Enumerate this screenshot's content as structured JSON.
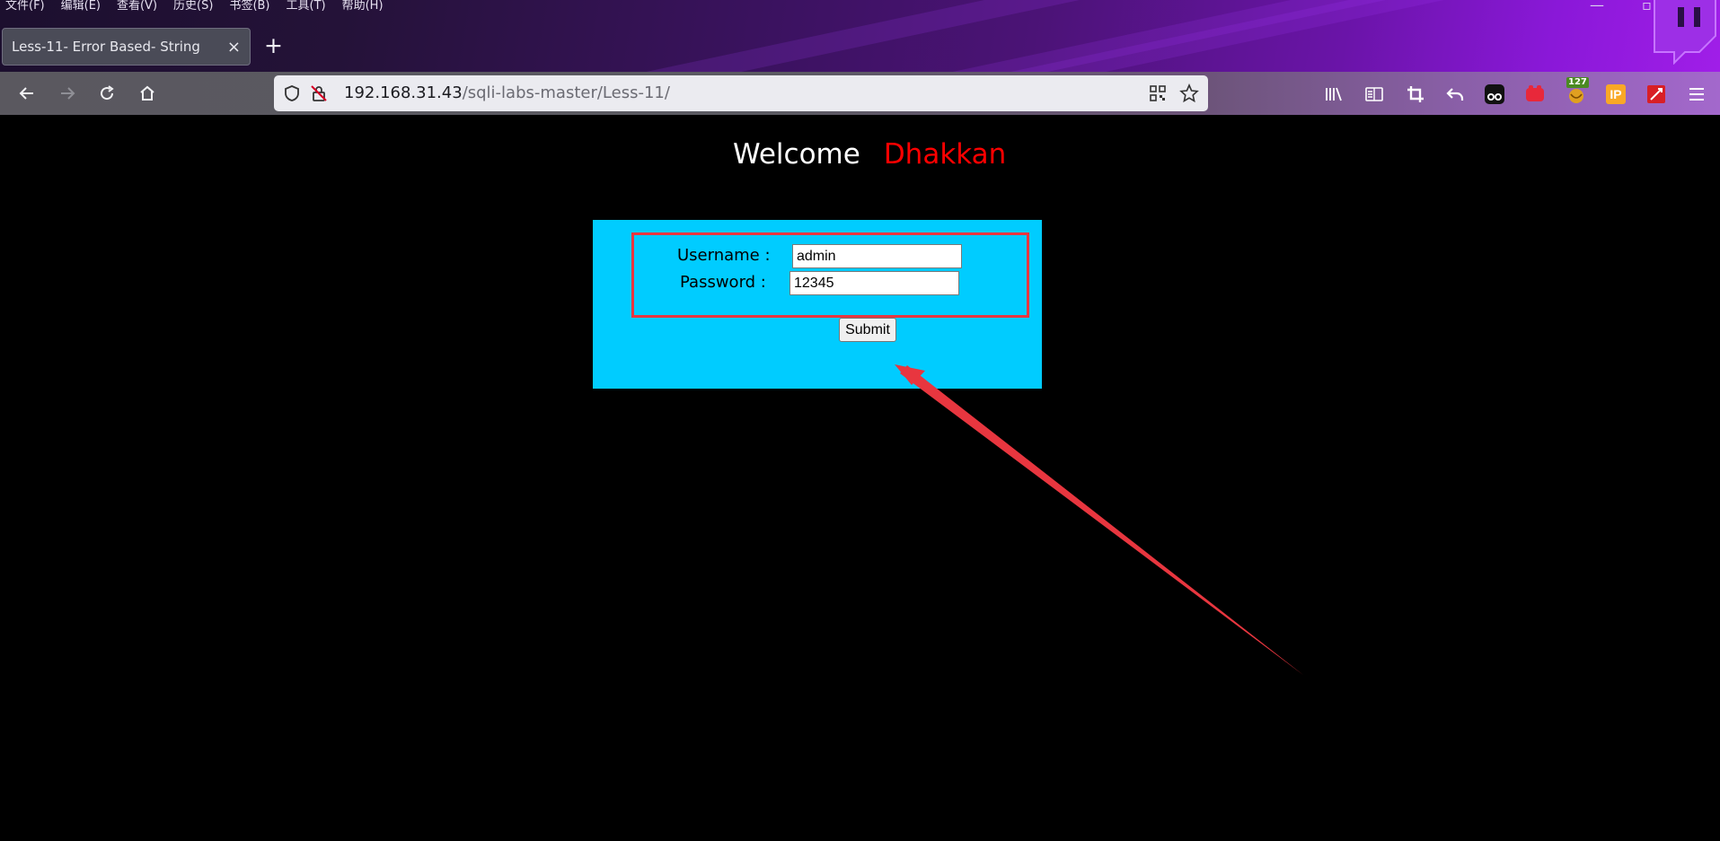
{
  "menu": [
    "文件(F)",
    "编辑(E)",
    "查看(V)",
    "历史(S)",
    "书签(B)",
    "工具(T)",
    "帮助(H)"
  ],
  "window_controls": {
    "minimize": "—",
    "restore": "▫",
    "close": "✕"
  },
  "tab": {
    "title": "Less-11- Error Based- String",
    "close": "×"
  },
  "new_tab": "+",
  "url": {
    "host": "192.168.31.43",
    "path": "/sqli-labs-master/Less-11/"
  },
  "toolbar_icons": [
    "library-icon",
    "reader-view-icon",
    "screenshot-crop-icon",
    "undo-icon",
    "tampermonkey-icon",
    "extension-red-icon",
    "extension-badge-icon",
    "ip-extension-icon",
    "hackbar-icon",
    "menu-icon"
  ],
  "extension_badge": "127",
  "ip_label": "IP",
  "page": {
    "welcome": "Welcome",
    "name": "Dhakkan",
    "username_label": "Username :",
    "username_value": "admin",
    "password_label": "Password :",
    "password_value": "12345",
    "submit_label": "Submit"
  },
  "colors": {
    "page_bg": "#000000",
    "form_bg": "#00ccff",
    "highlight_red": "#e8363f",
    "name_red": "#ff0000"
  }
}
